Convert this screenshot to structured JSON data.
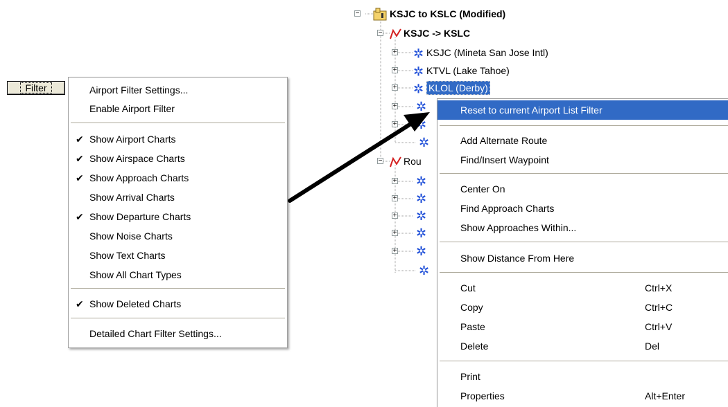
{
  "filter_button": {
    "label": "Filter"
  },
  "filter_menu": {
    "items": [
      {
        "label": "Airport Filter Settings...",
        "checked": false
      },
      {
        "label": "Enable Airport Filter",
        "checked": false
      },
      {
        "label": "Show Airport Charts",
        "checked": true
      },
      {
        "label": "Show Airspace Charts",
        "checked": true
      },
      {
        "label": "Show Approach Charts",
        "checked": true
      },
      {
        "label": "Show Arrival Charts",
        "checked": false
      },
      {
        "label": "Show Departure Charts",
        "checked": true
      },
      {
        "label": "Show Noise Charts",
        "checked": false
      },
      {
        "label": "Show Text Charts",
        "checked": false
      },
      {
        "label": "Show All Chart Types",
        "checked": false
      },
      {
        "label": "Show Deleted Charts",
        "checked": true
      },
      {
        "label": "Detailed Chart Filter Settings...",
        "checked": false
      }
    ],
    "check_glyph": "✔"
  },
  "tree": {
    "root": {
      "label": "KSJC to KSLC (Modified)",
      "icon": "trip-folder-icon",
      "expand": "−"
    },
    "route1": {
      "label": "KSJC -> KSLC",
      "icon": "route-icon",
      "expand": "−"
    },
    "waypoints": [
      {
        "label": "KSJC (Mineta San Jose Intl)",
        "icon": "waypoint-gear-icon",
        "expand": "+"
      },
      {
        "label": "KTVL (Lake Tahoe)",
        "icon": "waypoint-gear-icon",
        "expand": "+"
      },
      {
        "label": "KLOL (Derby)",
        "icon": "waypoint-gear-icon",
        "expand": "+"
      }
    ],
    "route2": {
      "label": "Rou",
      "icon": "route-icon",
      "expand": "−"
    }
  },
  "context_menu": {
    "items": [
      {
        "label": "Reset to current Airport List Filter",
        "shortcut": ""
      },
      {
        "label": "Add Alternate Route",
        "shortcut": ""
      },
      {
        "label": "Find/Insert Waypoint",
        "shortcut": ""
      },
      {
        "label": "Center On",
        "shortcut": ""
      },
      {
        "label": "Find Approach Charts",
        "shortcut": ""
      },
      {
        "label": "Show Approaches Within...",
        "shortcut": ""
      },
      {
        "label": "Show Distance From Here",
        "shortcut": ""
      },
      {
        "label": "Cut",
        "shortcut": "Ctrl+X"
      },
      {
        "label": "Copy",
        "shortcut": "Ctrl+C"
      },
      {
        "label": "Paste",
        "shortcut": "Ctrl+V"
      },
      {
        "label": "Delete",
        "shortcut": "Del"
      },
      {
        "label": "Print",
        "shortcut": ""
      },
      {
        "label": "Properties",
        "shortcut": "Alt+Enter"
      }
    ]
  },
  "colors": {
    "highlight": "#316ac5",
    "menu_face": "#ece9d8",
    "icon_blue": "#1f4fd8",
    "route_red": "#d42020"
  }
}
